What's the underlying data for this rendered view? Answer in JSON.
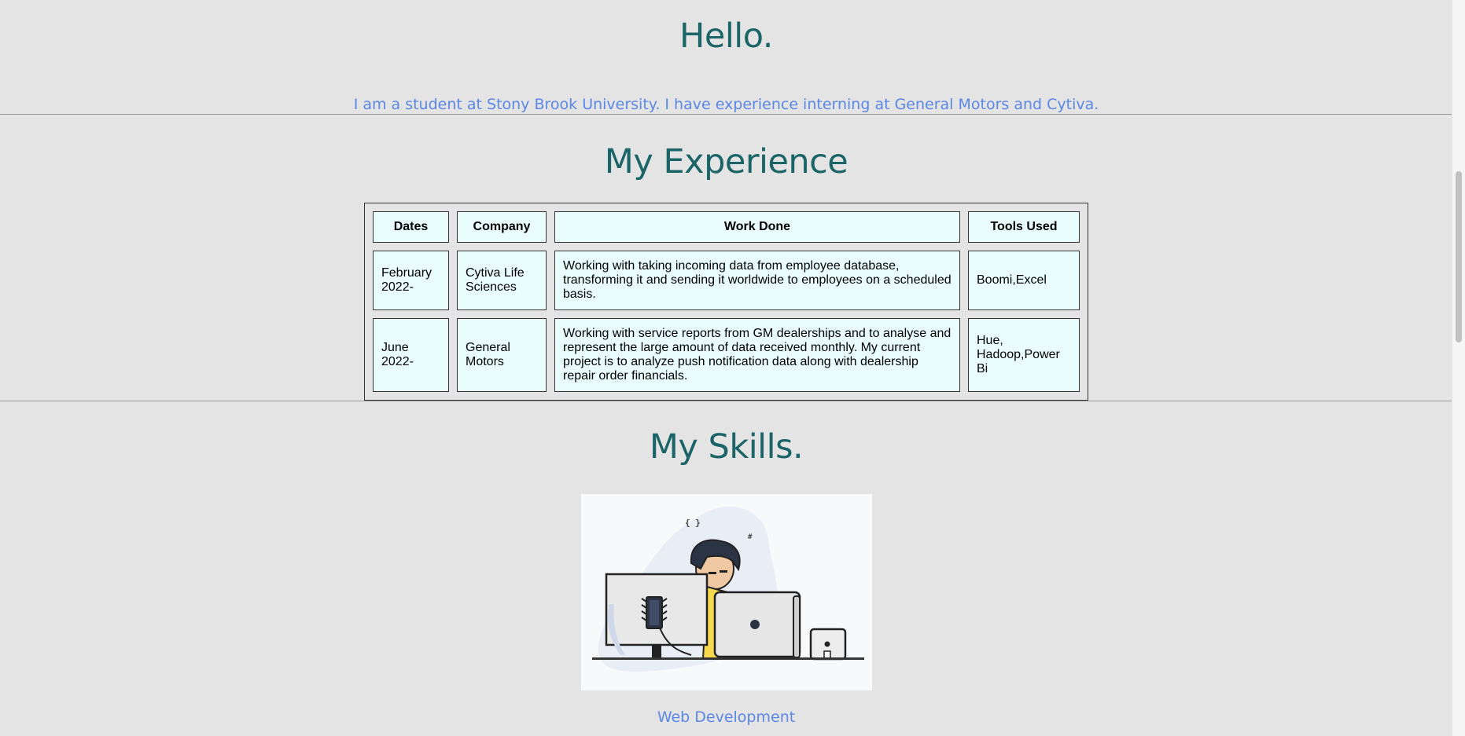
{
  "hero": {
    "title": "Hello.",
    "intro": "I am a student at Stony Brook University. I have experience interning at General Motors and Cytiva."
  },
  "experience": {
    "title": "My Experience",
    "columns": [
      "Dates",
      "Company",
      "Work Done",
      "Tools Used"
    ],
    "rows": [
      {
        "dates": "February 2022-",
        "company": "Cytiva Life Sciences",
        "work": "Working with taking incoming data from employee database, transforming it and sending it worldwide to employees on a scheduled basis.",
        "tools": "Boomi,Excel"
      },
      {
        "dates": "June 2022-",
        "company": "General Motors",
        "work": "Working with service reports from GM dealerships and to analyse and represent the large amount of data received monthly. My current project is to analyze push notification data along with dealership repair order financials.",
        "tools": "Hue, Hadoop,Power Bi"
      }
    ]
  },
  "skills": {
    "title": "My Skills.",
    "image_alt": "developer-at-desk-illustration",
    "image_symbols": [
      "{ }",
      "#"
    ],
    "caption": "Web Development"
  },
  "colors": {
    "heading": "#1b6468",
    "accent_text": "#5b87e8",
    "page_bg": "#e4e4e4",
    "cell_bg": "#e9fdfd"
  }
}
